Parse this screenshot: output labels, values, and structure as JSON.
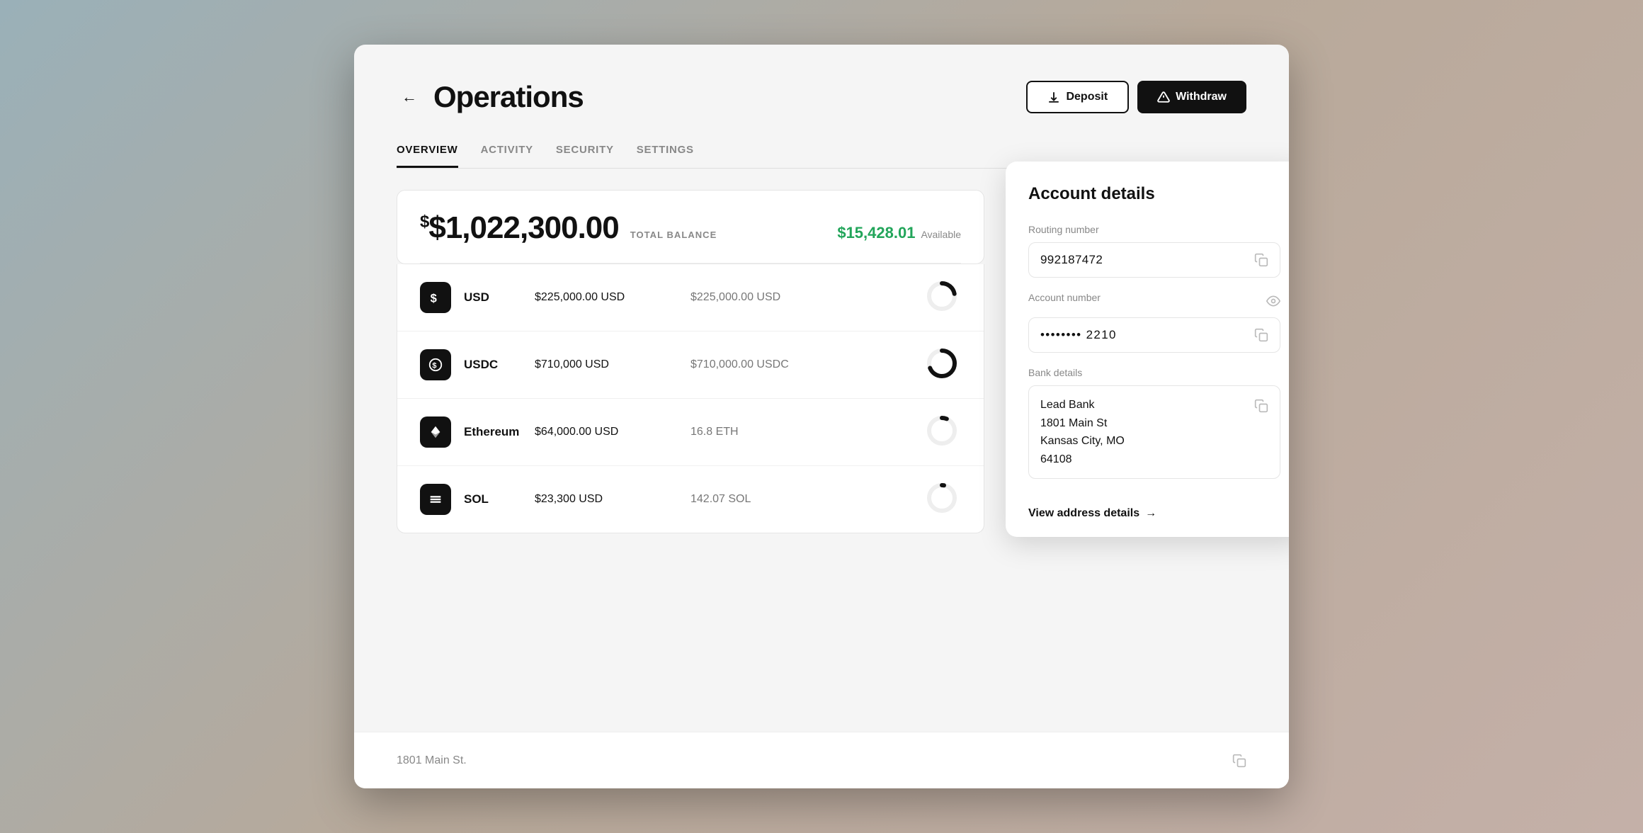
{
  "page": {
    "title": "Operations",
    "back_label": "←"
  },
  "tabs": [
    {
      "id": "overview",
      "label": "OVERVIEW",
      "active": true
    },
    {
      "id": "activity",
      "label": "ACTIVITY",
      "active": false
    },
    {
      "id": "security",
      "label": "SECURITY",
      "active": false
    },
    {
      "id": "settings",
      "label": "SETTINGS",
      "active": false
    }
  ],
  "header_actions": {
    "deposit_label": "Deposit",
    "withdraw_label": "Withdraw"
  },
  "balance": {
    "total": "$1,022,300.00",
    "total_label": "TOTAL BALANCE",
    "available": "$15,428.01",
    "available_label": "Available"
  },
  "assets": [
    {
      "name": "USD",
      "usd_value": "$225,000.00 USD",
      "token_value": "$225,000.00 USD",
      "icon": "dollar",
      "chart_percent": 22
    },
    {
      "name": "USDC",
      "usd_value": "$710,000 USD",
      "token_value": "$710,000.00 USDC",
      "icon": "usdc",
      "chart_percent": 69
    },
    {
      "name": "Ethereum",
      "usd_value": "$64,000.00 USD",
      "token_value": "16.8 ETH",
      "icon": "eth",
      "chart_percent": 6
    },
    {
      "name": "SOL",
      "usd_value": "$23,300 USD",
      "token_value": "142.07 SOL",
      "icon": "sol",
      "chart_percent": 2
    }
  ],
  "account_details": {
    "panel_title": "Account details",
    "routing_label": "Routing number",
    "routing_value": "992187472",
    "account_label": "Account number",
    "account_value": "•••••••• 2210",
    "bank_label": "Bank details",
    "bank_address": "Lead Bank\n1801 Main St\nKansas City, MO\n64108",
    "view_address_label": "View address details",
    "bottom_address": "1801 Main St."
  }
}
